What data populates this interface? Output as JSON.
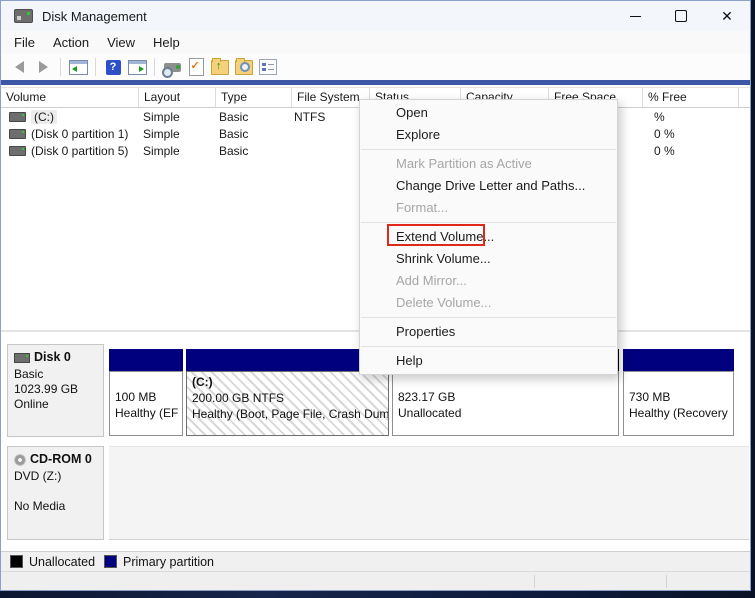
{
  "window": {
    "title": "Disk Management",
    "controls": {
      "close_glyph": "✕"
    }
  },
  "menu_bar": {
    "items": [
      {
        "label": "File"
      },
      {
        "label": "Action"
      },
      {
        "label": "View"
      },
      {
        "label": "Help"
      }
    ]
  },
  "toolbar": {
    "icons": [
      "back",
      "forward",
      "show-console-tree",
      "help",
      "action-pane",
      "rescan-disks",
      "task-check",
      "export-up",
      "find",
      "properties-list"
    ],
    "help_glyph": "?"
  },
  "volume_list": {
    "columns": [
      "Volume",
      "Layout",
      "Type",
      "File System",
      "Status",
      "Capacity",
      "Free Space",
      "% Free",
      ""
    ],
    "rows": [
      {
        "volume": "(C:)",
        "layout": "Simple",
        "type": "Basic",
        "file_system": "NTFS",
        "status": "",
        "capacity": "",
        "free_space": "",
        "pct_free": "%"
      },
      {
        "volume": "(Disk 0 partition 1)",
        "layout": "Simple",
        "type": "Basic",
        "file_system": "",
        "status": "",
        "capacity": "",
        "free_space": "",
        "pct_free": "0 %"
      },
      {
        "volume": "(Disk 0 partition 5)",
        "layout": "Simple",
        "type": "Basic",
        "file_system": "",
        "status": "",
        "capacity": "",
        "free_space": "",
        "pct_free": "0 %"
      }
    ]
  },
  "context_menu": {
    "items": [
      {
        "label": "Open",
        "enabled": true
      },
      {
        "label": "Explore",
        "enabled": true
      },
      {
        "separator": true
      },
      {
        "label": "Mark Partition as Active",
        "enabled": false
      },
      {
        "label": "Change Drive Letter and Paths...",
        "enabled": true
      },
      {
        "label": "Format...",
        "enabled": false
      },
      {
        "separator": true
      },
      {
        "label": "Extend Volume...",
        "enabled": true,
        "annotated": true
      },
      {
        "label": "Shrink Volume...",
        "enabled": true
      },
      {
        "label": "Add Mirror...",
        "enabled": false
      },
      {
        "label": "Delete Volume...",
        "enabled": false
      },
      {
        "separator": true
      },
      {
        "label": "Properties",
        "enabled": true
      },
      {
        "separator": true
      },
      {
        "label": "Help",
        "enabled": true
      }
    ],
    "annotation_color": "#e0271c"
  },
  "disk0": {
    "name": "Disk 0",
    "type": "Basic",
    "size": "1023.99 GB",
    "status": "Online",
    "partitions": [
      {
        "kind": "primary",
        "lines": [
          "100 MB",
          "Healthy (EF"
        ]
      },
      {
        "kind": "primary",
        "selected": true,
        "lines": [
          "(C:)",
          "200.00 GB NTFS",
          "Healthy (Boot, Page File, Crash Dum"
        ]
      },
      {
        "kind": "unallocated",
        "lines": [
          "823.17 GB",
          "Unallocated"
        ]
      },
      {
        "kind": "primary",
        "lines": [
          "730 MB",
          "Healthy (Recovery"
        ]
      }
    ]
  },
  "cdrom": {
    "name": "CD-ROM 0",
    "drive": "DVD (Z:)",
    "status": "No Media"
  },
  "legend": {
    "items": [
      {
        "label": "Unallocated",
        "color": "#000000"
      },
      {
        "label": "Primary partition",
        "color": "#00007f"
      }
    ]
  },
  "colors": {
    "primary_partition": "#00007f",
    "unallocated": "#000000",
    "annotation": "#e0271c"
  }
}
